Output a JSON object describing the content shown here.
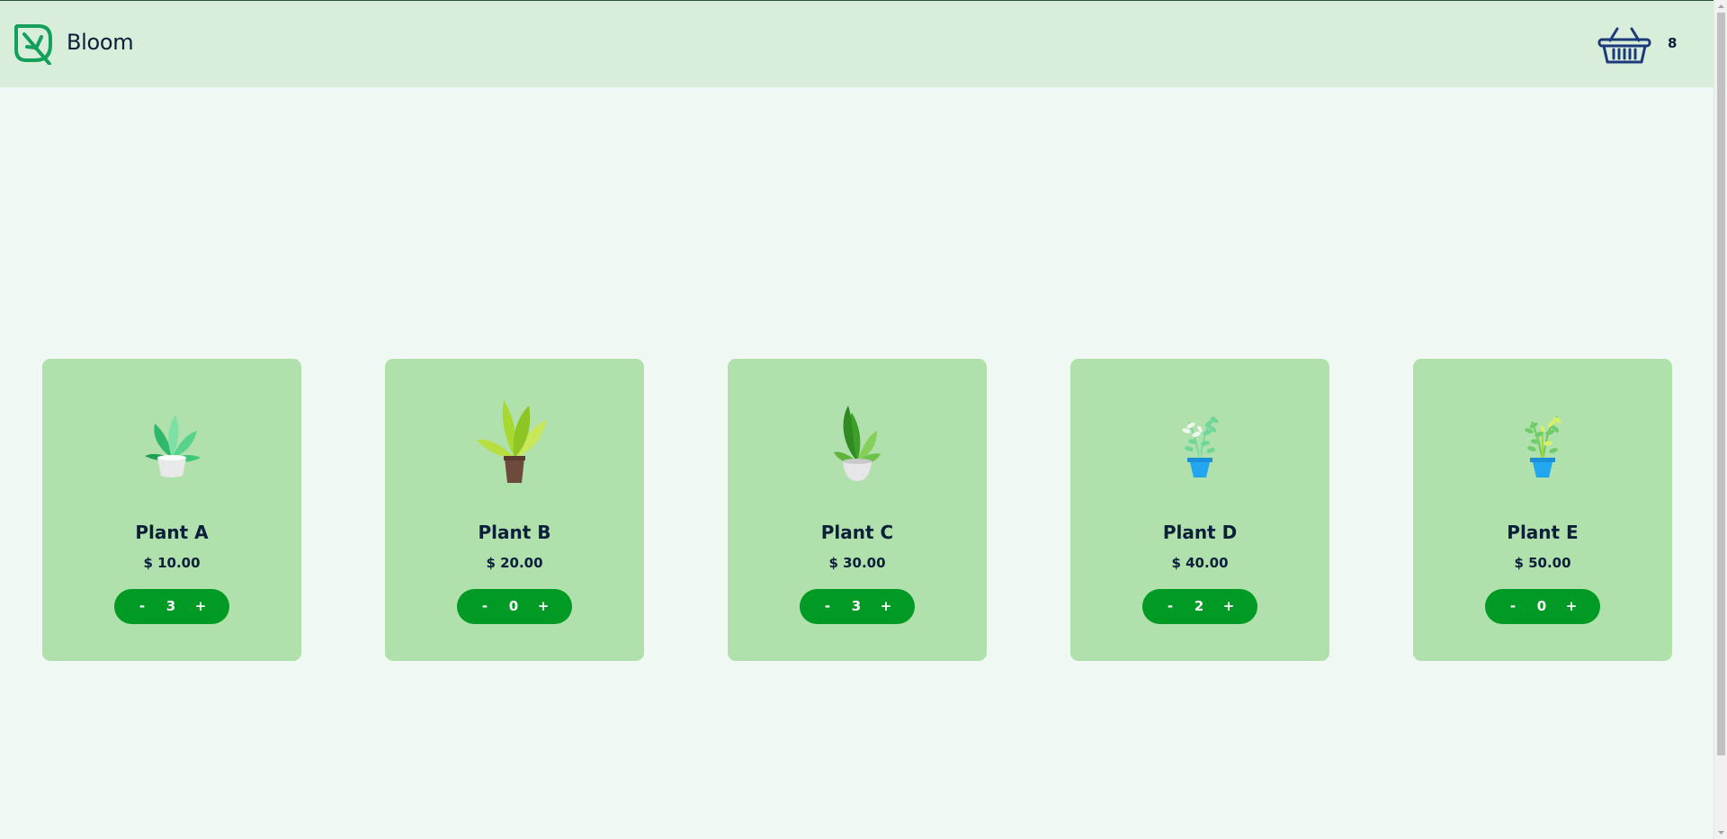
{
  "header": {
    "brand": "Bloom",
    "logo_icon": "leaf-logo-icon",
    "cart_icon": "basket-icon",
    "cart_count": "8"
  },
  "colors": {
    "header_bg": "#d8eedb",
    "page_bg": "#eff8f3",
    "card_bg": "#b0e0ab",
    "accent": "#009a24",
    "text": "#0b1f3a"
  },
  "products": [
    {
      "name": "Plant A",
      "price": "$ 10.00",
      "quantity": "3",
      "minus_label": "-",
      "plus_label": "+",
      "image_icon": "potted-plant-icon"
    },
    {
      "name": "Plant B",
      "price": "$ 20.00",
      "quantity": "0",
      "minus_label": "-",
      "plus_label": "+",
      "image_icon": "potted-plant-icon"
    },
    {
      "name": "Plant C",
      "price": "$ 30.00",
      "quantity": "3",
      "minus_label": "-",
      "plus_label": "+",
      "image_icon": "potted-plant-icon"
    },
    {
      "name": "Plant D",
      "price": "$ 40.00",
      "quantity": "2",
      "minus_label": "-",
      "plus_label": "+",
      "image_icon": "potted-plant-icon"
    },
    {
      "name": "Plant E",
      "price": "$ 50.00",
      "quantity": "0",
      "minus_label": "-",
      "plus_label": "+",
      "image_icon": "potted-plant-icon"
    }
  ]
}
